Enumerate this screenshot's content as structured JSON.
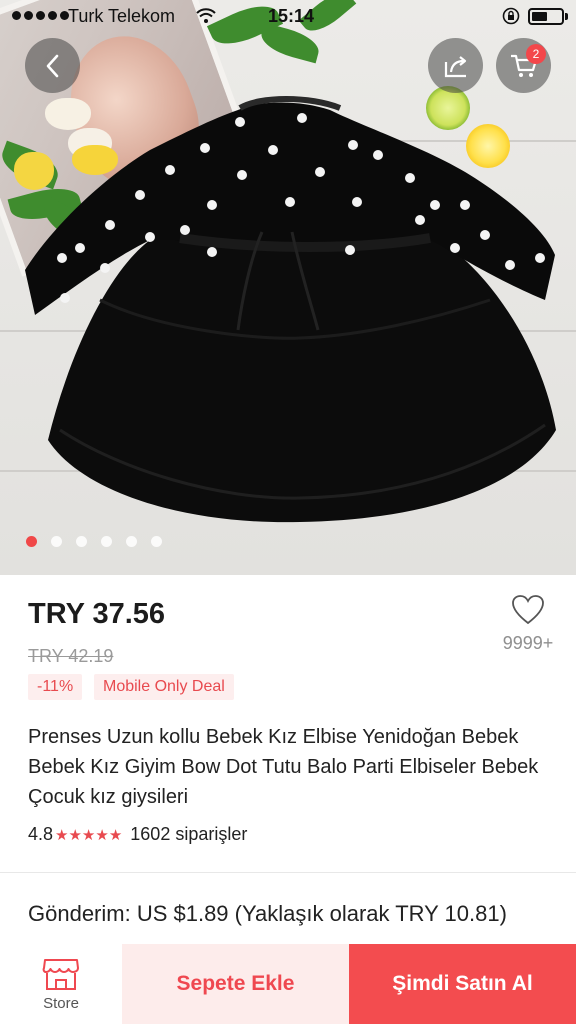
{
  "status_bar": {
    "carrier": "Turk Telekom",
    "time": "15:14",
    "battery_level": 0.55
  },
  "product_image": {
    "cart_count": "2",
    "pager": {
      "total": 6,
      "active": 1
    }
  },
  "product": {
    "price": "TRY 37.56",
    "old_price": "TRY 42.19",
    "discount": "-11%",
    "deal_badge": "Mobile Only Deal",
    "wishlist_count": "9999+",
    "title": "Prenses Uzun kollu Bebek Kız Elbise Yenidoğan Bebek Bebek Kız Giyim Bow Dot Tutu Balo Parti Elbiseler Bebek Çocuk kız giysileri",
    "rating": "4.8",
    "stars": "★★★★★",
    "orders": "1602 siparişler",
    "shipping": "Gönderim: US $1.89 (Yaklaşık olarak TRY 10.81)"
  },
  "bottom_bar": {
    "store_label": "Store",
    "add_to_cart": "Sepete Ekle",
    "buy_now": "Şimdi Satın Al"
  },
  "colors": {
    "accent": "#f34c4f",
    "accent_light": "#fdeceb"
  },
  "icons": [
    "back-arrow-icon",
    "share-icon",
    "cart-icon",
    "heart-icon",
    "store-icon",
    "wifi-icon",
    "lock-rotation-icon"
  ]
}
